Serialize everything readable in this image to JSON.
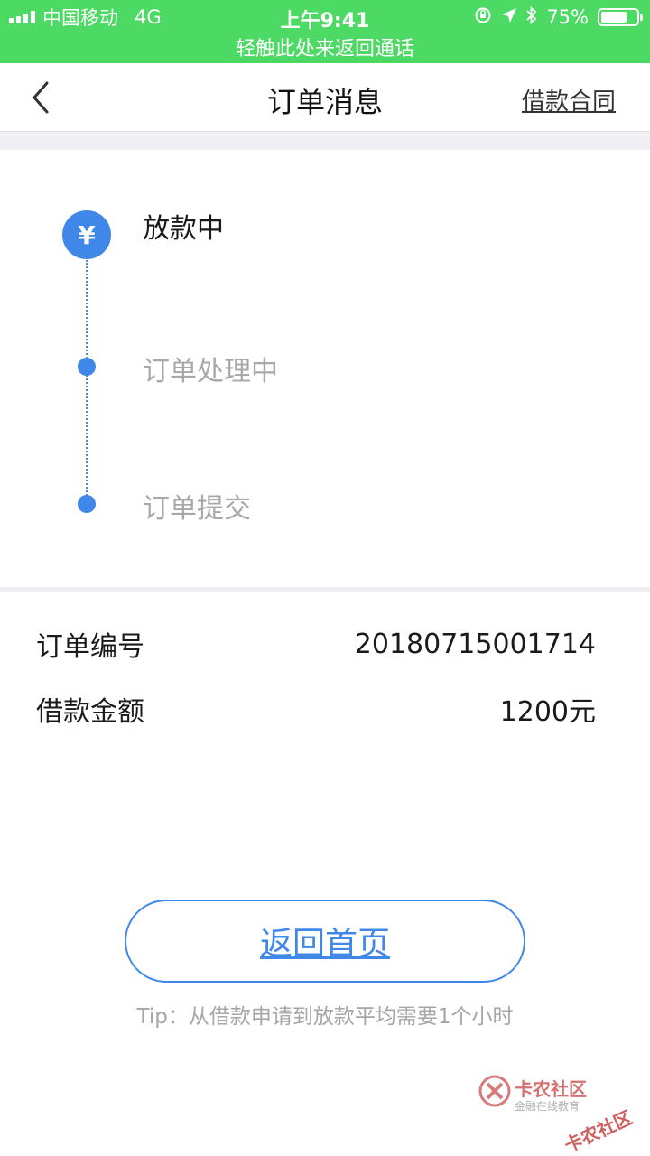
{
  "status_bar": {
    "carrier": "中国移动",
    "network": "4G",
    "time": "上午9:41",
    "battery": "75%",
    "battery_level": 0.75,
    "call_return": "轻触此处来返回通话"
  },
  "nav": {
    "title": "订单消息",
    "contract_link": "借款合同"
  },
  "timeline": {
    "steps": [
      {
        "label": "放款中",
        "state": "active",
        "icon": "yuan-icon",
        "icon_text": "¥"
      },
      {
        "label": "订单处理中",
        "state": "inactive"
      },
      {
        "label": "订单提交",
        "state": "inactive"
      }
    ]
  },
  "details": {
    "rows": [
      {
        "label": "订单编号",
        "value": "20180715001714"
      },
      {
        "label": "借款金额",
        "value": "1200元"
      }
    ]
  },
  "actions": {
    "home_button": "返回首页"
  },
  "tip": "Tip：从借款申请到放款平均需要1个小时",
  "watermark": {
    "title": "卡农社区",
    "subtitle": "金融在线教育",
    "stamp": "卡农社区"
  },
  "colors": {
    "status_green": "#4cd964",
    "accent_blue": "#3f87e8",
    "inactive_text": "#a8a8a8",
    "watermark_red": "#c9504f"
  }
}
